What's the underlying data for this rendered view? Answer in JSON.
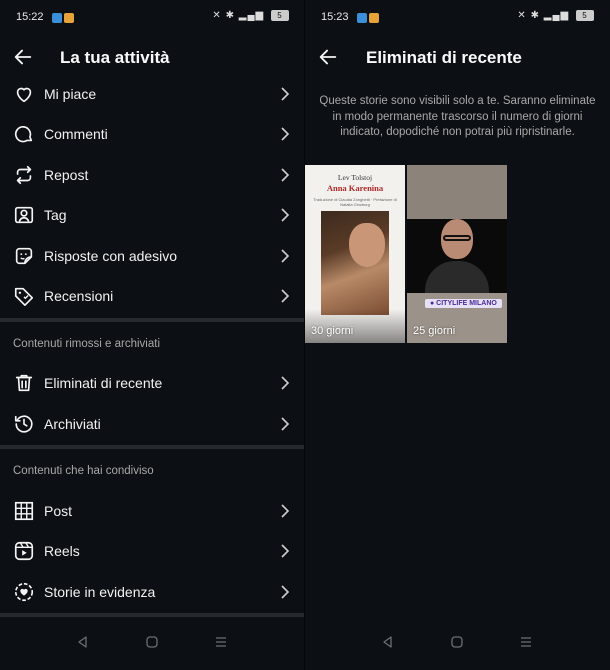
{
  "left": {
    "status": {
      "time": "15:22",
      "battery": "5"
    },
    "header": {
      "title": "La tua attività"
    },
    "items_top": [
      {
        "label": "Mi piace",
        "icon": "heart-icon"
      },
      {
        "label": "Commenti",
        "icon": "comment-icon"
      },
      {
        "label": "Repost",
        "icon": "repost-icon"
      },
      {
        "label": "Tag",
        "icon": "tag-user-icon"
      },
      {
        "label": "Risposte con adesivo",
        "icon": "sticker-icon"
      },
      {
        "label": "Recensioni",
        "icon": "review-tag-icon"
      }
    ],
    "section1": {
      "title": "Contenuti rimossi e archiviati",
      "items": [
        {
          "label": "Eliminati di recente",
          "icon": "trash-icon"
        },
        {
          "label": "Archiviati",
          "icon": "archive-clock-icon"
        }
      ]
    },
    "section2": {
      "title": "Contenuti che hai condiviso",
      "items": [
        {
          "label": "Post",
          "icon": "grid-icon"
        },
        {
          "label": "Reels",
          "icon": "reels-icon"
        },
        {
          "label": "Storie in evidenza",
          "icon": "highlights-icon"
        }
      ]
    }
  },
  "right": {
    "status": {
      "time": "15:23",
      "battery": "5"
    },
    "header": {
      "title": "Eliminati di recente"
    },
    "info": "Queste storie sono visibili solo a te. Saranno eliminate in modo permanente trascorso il numero di giorni indicato, dopodiché non potrai più ripristinarle.",
    "stories": [
      {
        "days": "30 giorni",
        "author": "Lev Tolstoj",
        "book_title": "Anna Karenina",
        "book_sub": "Traduzione di Claudia Zonghetti · Prefazione di Natalia Ginzburg"
      },
      {
        "days": "25 giorni",
        "badge": "● CITYLIFE MILANO"
      }
    ]
  },
  "colors": {
    "background": "#0c1014",
    "text": "#f5f5f5",
    "muted": "#a8a8a8",
    "separator": "#262a2e"
  }
}
